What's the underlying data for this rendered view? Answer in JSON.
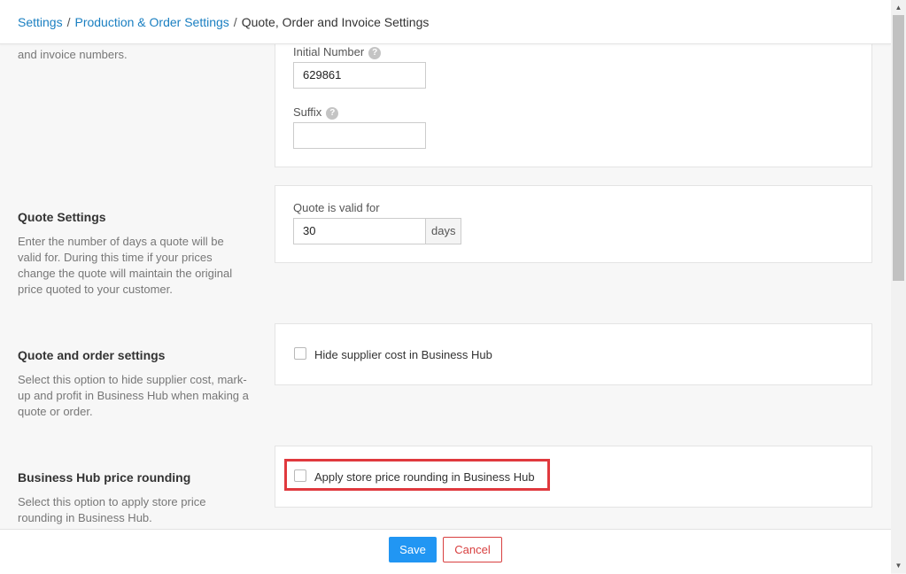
{
  "breadcrumb": {
    "items": [
      "Settings",
      "Production & Order Settings"
    ],
    "separator": "/",
    "current": "Quote, Order and Invoice Settings"
  },
  "numbering": {
    "desc_fragment": "and invoice numbers.",
    "initial_number_label": "Initial Number",
    "initial_number_value": "629861",
    "suffix_label": "Suffix",
    "suffix_value": "",
    "help_glyph": "?"
  },
  "quote_settings": {
    "title": "Quote Settings",
    "description": "Enter the number of days a quote will be valid for. During this time if your prices change the quote will maintain the original price quoted to your customer.",
    "valid_label": "Quote is valid for",
    "valid_value": "30",
    "unit": "days"
  },
  "quote_order_settings": {
    "title": "Quote and order settings",
    "description": "Select this option to hide supplier cost, mark-up and profit in Business Hub when making a quote or order.",
    "checkbox_label": "Hide supplier cost in Business Hub",
    "checked": false
  },
  "price_rounding": {
    "title": "Business Hub price rounding",
    "description": "Select this option to apply store price rounding in Business Hub.",
    "checkbox_label": "Apply store price rounding in Business Hub",
    "checked": false,
    "highlight_color": "#e0393e"
  },
  "footer": {
    "save_label": "Save",
    "cancel_label": "Cancel"
  },
  "colors": {
    "link": "#1a7fc1",
    "primary": "#2196f3",
    "danger": "#d84040"
  },
  "icons": {
    "help": "question-circle-icon",
    "scroll_up": "chevron-up-icon",
    "scroll_down": "chevron-down-icon"
  }
}
